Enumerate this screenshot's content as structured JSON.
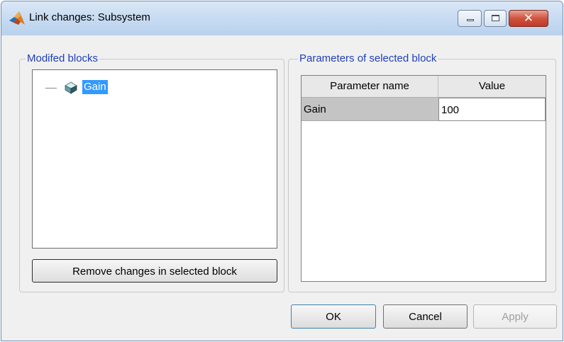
{
  "window": {
    "title": "Link changes: Subsystem",
    "close_symbol": "✕"
  },
  "left_panel": {
    "legend": "Modifed blocks",
    "tree_items": [
      {
        "label": "Gain",
        "icon": "block-cube-icon",
        "selected": true
      }
    ],
    "remove_button_label": "Remove changes in selected block"
  },
  "right_panel": {
    "legend": "Parameters of selected block",
    "columns": [
      "Parameter name",
      "Value"
    ],
    "rows": [
      {
        "name": "Gain",
        "value": "100"
      }
    ]
  },
  "buttons": {
    "ok": "OK",
    "cancel": "Cancel",
    "apply": "Apply"
  },
  "colors": {
    "legend_text": "#1f3fb8",
    "selection": "#3399ff",
    "close_button": "#d0533f"
  }
}
